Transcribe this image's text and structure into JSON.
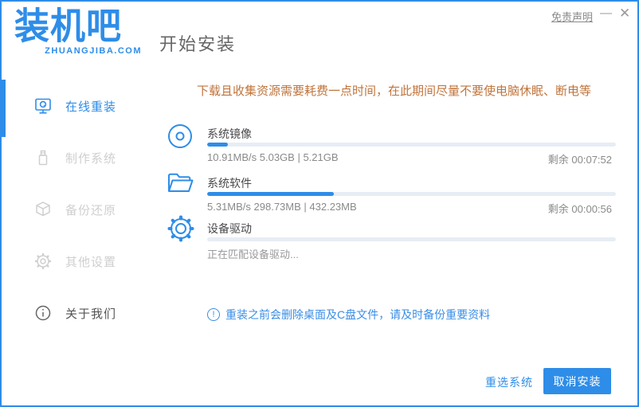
{
  "window": {
    "logo_title": "装机吧",
    "logo_subtitle": "ZHUANGJIBA.COM",
    "page_title": "开始安装",
    "titlebar": {
      "disclaimer": "免责声明",
      "minimize": "—",
      "close": "✕"
    }
  },
  "sidebar": {
    "items": [
      {
        "label": "在线重装",
        "icon": "monitor-icon",
        "state": "active"
      },
      {
        "label": "制作系统",
        "icon": "usb-icon",
        "state": "disabled"
      },
      {
        "label": "备份还原",
        "icon": "backup-icon",
        "state": "disabled"
      },
      {
        "label": "其他设置",
        "icon": "settings-icon",
        "state": "disabled"
      },
      {
        "label": "关于我们",
        "icon": "info-icon",
        "state": "normal"
      }
    ]
  },
  "main": {
    "warning": "下载且收集资源需要耗费一点时间，在此期间尽量不要使电脑休眠、断电等",
    "tasks": [
      {
        "name": "系统镜像",
        "icon": "disc-icon",
        "progress_percent": 5,
        "stats": "10.91MB/s 5.03GB | 5.21GB",
        "remaining": "剩余 00:07:52"
      },
      {
        "name": "系统软件",
        "icon": "folder-icon",
        "progress_percent": 31,
        "stats": "5.31MB/s 298.73MB | 432.23MB",
        "remaining": "剩余 00:00:56"
      },
      {
        "name": "设备驱动",
        "icon": "gear-icon",
        "progress_percent": 0,
        "status": "正在匹配设备驱动..."
      }
    ],
    "notice": "重装之前会删除桌面及C盘文件，请及时备份重要资料",
    "notice_icon": "!",
    "buttons": {
      "reselect": "重选系统",
      "cancel": "取消安装"
    }
  },
  "colors": {
    "accent_blue": "#2e8de8",
    "warning_text": "#c0743c",
    "notice_blue": "#3a8ee6",
    "disabled_gray": "#cfcfcf",
    "track_gray": "#e7edf4",
    "border_blue": "#2f8ce8"
  }
}
